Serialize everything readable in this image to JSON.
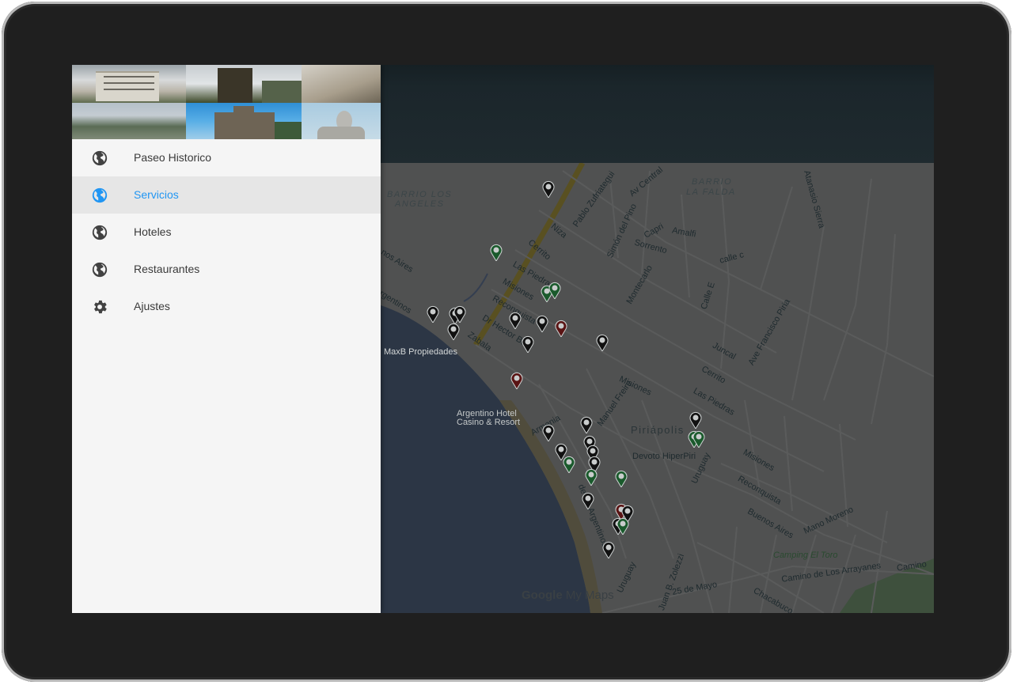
{
  "drawer": {
    "items": [
      {
        "label": "Paseo Historico",
        "icon": "globe-icon",
        "active": false
      },
      {
        "label": "Servicios",
        "icon": "globe-icon",
        "active": true
      },
      {
        "label": "Hoteles",
        "icon": "globe-icon",
        "active": false
      },
      {
        "label": "Restaurantes",
        "icon": "globe-icon",
        "active": false
      },
      {
        "label": "Ajustes",
        "icon": "gear-icon",
        "active": false
      }
    ]
  },
  "map": {
    "labels": {
      "barrio_los_angeles_1": "BARRIO LOS",
      "barrio_los_angeles_2": "ANGELES",
      "barrio_la_falda_1": "BARRIO",
      "barrio_la_falda_2": "LA FALDA",
      "maxb": "MaxB Propiedades",
      "argentino_1": "Argentino Hotel",
      "argentino_2": "Casino & Resort",
      "piriapolis": "Piriápolis",
      "devoto": "Devoto HiperPiri",
      "camping": "Camping El Toro",
      "pablo_zufriategui": "Pablo Zufriategui",
      "av_central": "Av Central",
      "simon_del_pino": "Simón del Pino",
      "capri": "Capri",
      "sorrento": "Sorrento",
      "amalfi": "Amalfi",
      "atanasio_sierra": "Atanasio Sierra",
      "calle_c": "calle c",
      "calle_e": "Calle E",
      "niza": "Niza",
      "cerrito": "Cerrito",
      "las_piedras": "Las Piedras",
      "misiones": "Misiones",
      "reconquista": "Reconquista",
      "dr_hector": "Dr Hector Barr",
      "buenos_aires": "nos Aires",
      "argentinos": "rgentinos",
      "montecarlo": "Montecarlo",
      "juncal": "Juncal",
      "ave_francisco_piria": "Ave Francisco Piria",
      "cerrito_2": "Cerrito",
      "las_piedras_2": "Las Piedras",
      "misiones_2": "Misiones",
      "manuel_freire": "Manuel Freire",
      "armenia": "Armenia",
      "misiones_3": "Misiones",
      "reconquista_2": "Reconquista",
      "buenos_aires_2": "Buenos Aires",
      "mano_moreno": "Mano Moreno",
      "uruguay": "Uruguay",
      "uruguay_2": "Uruguay",
      "juan_b_zolezzi": "Juan B. Zolezzi",
      "25_de_mayo": "25 de Mayo",
      "camino_arrayanes": "Camino de Los Arrayanes",
      "camino_2": "Camino",
      "chacabuco": "Chacabuco",
      "zabala": "Zabala",
      "de_argentinos": "de los Argentinos"
    },
    "attribution": {
      "google": "Google",
      "mymaps": " My Maps"
    }
  },
  "colors": {
    "accent": "#2196f3",
    "drawer_bg": "#f5f5f5",
    "active_bg": "#e6e6e6"
  }
}
